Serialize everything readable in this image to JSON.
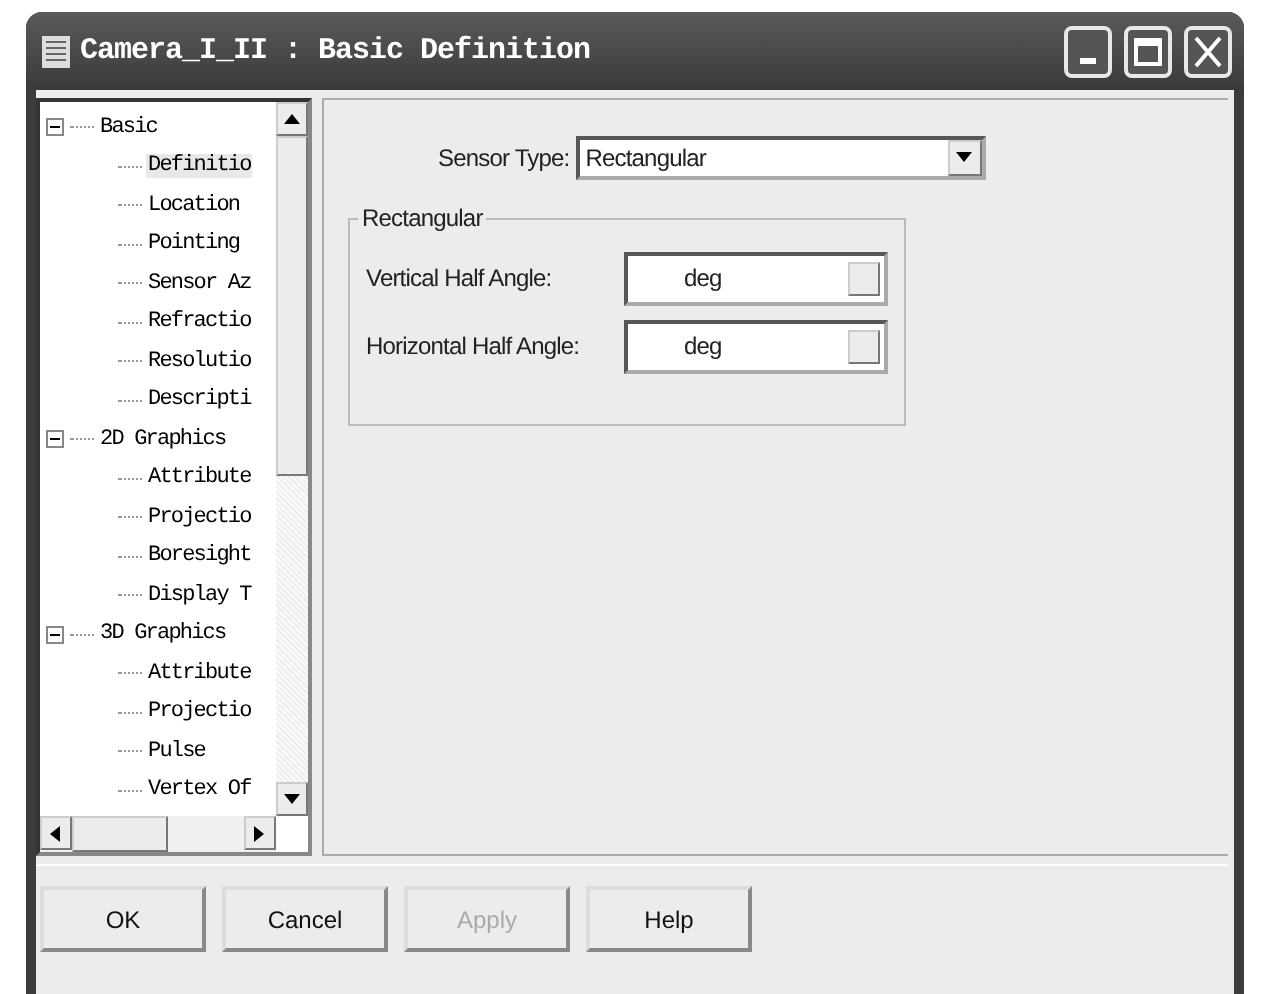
{
  "window": {
    "title": "Camera_I_II : Basic Definition"
  },
  "tree": [
    {
      "label": "Basic",
      "expanded": true,
      "selected": false,
      "children": [
        {
          "label": "Definitio",
          "selected": true
        },
        {
          "label": "Location",
          "selected": false
        },
        {
          "label": "Pointing",
          "selected": false
        },
        {
          "label": "Sensor Az",
          "selected": false
        },
        {
          "label": "Refractio",
          "selected": false
        },
        {
          "label": "Resolutio",
          "selected": false
        },
        {
          "label": "Descripti",
          "selected": false
        }
      ]
    },
    {
      "label": "2D Graphics",
      "expanded": true,
      "selected": false,
      "children": [
        {
          "label": "Attribute",
          "selected": false
        },
        {
          "label": "Projectio",
          "selected": false
        },
        {
          "label": "Boresight",
          "selected": false
        },
        {
          "label": "Display T",
          "selected": false
        }
      ]
    },
    {
      "label": "3D Graphics",
      "expanded": true,
      "selected": false,
      "children": [
        {
          "label": "Attribute",
          "selected": false
        },
        {
          "label": "Projectio",
          "selected": false
        },
        {
          "label": "Pulse",
          "selected": false
        },
        {
          "label": "Vertex Of",
          "selected": false
        }
      ]
    }
  ],
  "sensor_type": {
    "label": "Sensor Type:",
    "value": "Rectangular"
  },
  "group": {
    "title": "Rectangular",
    "fields": [
      {
        "label": "Vertical Half Angle:",
        "unit": "deg"
      },
      {
        "label": "Horizontal Half Angle:",
        "unit": "deg"
      }
    ]
  },
  "buttons": [
    {
      "label": "OK",
      "disabled": false
    },
    {
      "label": "Cancel",
      "disabled": false
    },
    {
      "label": "Apply",
      "disabled": true
    },
    {
      "label": "Help",
      "disabled": false
    }
  ]
}
